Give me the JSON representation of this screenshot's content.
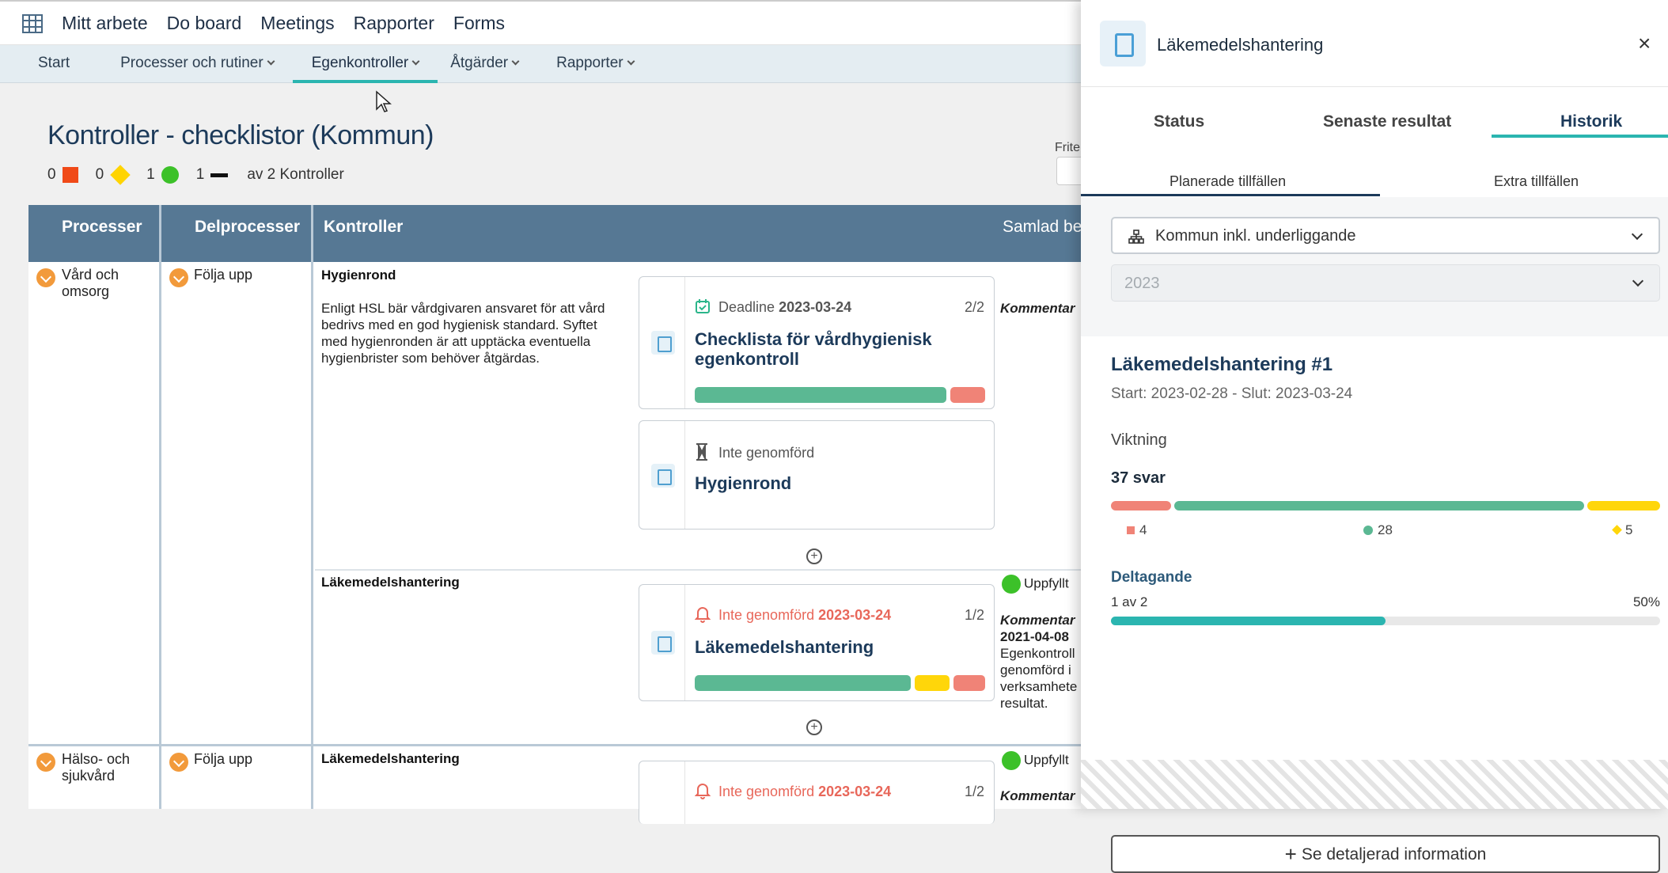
{
  "topnav": [
    "Mitt arbete",
    "Do board",
    "Meetings",
    "Rapporter",
    "Forms"
  ],
  "subnav": [
    {
      "label": "Start",
      "dropdown": false,
      "active": false
    },
    {
      "label": "Processer och rutiner",
      "dropdown": true,
      "active": false
    },
    {
      "label": "Egenkontroller",
      "dropdown": true,
      "active": true
    },
    {
      "label": "Åtgärder",
      "dropdown": true,
      "active": false
    },
    {
      "label": "Rapporter",
      "dropdown": true,
      "active": false
    }
  ],
  "page": {
    "title": "Kontroller - checklistor (Kommun)",
    "counts": {
      "red": "0",
      "yellow": "0",
      "green": "1",
      "black": "1",
      "suffix": "av 2 Kontroller"
    },
    "fritext_label": "Frite"
  },
  "table": {
    "headers": {
      "processer": "Processer",
      "delprocesser": "Delprocesser",
      "kontroller": "Kontroller",
      "samlad": "Samlad be"
    },
    "rows": [
      {
        "process": "Vård och omsorg",
        "delprocess": "Följa upp"
      },
      {
        "process": "Hälso- och sjukvård",
        "delprocess": "Följa upp"
      }
    ],
    "controls": [
      {
        "title": "Hygienrond",
        "desc": "Enligt HSL bär vårdgivaren ansvaret för att vård bedrivs med en god hygienisk standard. Syftet med hygienronden är att upptäcka eventuella hygienbrister som behöver åtgärdas.",
        "samlad_kommentar": "Kommentar",
        "cards": [
          {
            "status_prefix": "Deadline",
            "status_date": "2023-03-24",
            "frac": "2/2",
            "name": "Checklista för vårdhygienisk egenkontroll"
          },
          {
            "status_prefix": "Inte genomförd",
            "status_date": "",
            "frac": "",
            "name": "Hygienrond"
          }
        ]
      },
      {
        "title": "Läkemedelshantering",
        "samlad_status": "Uppfyllt",
        "samlad_kommentar": "Kommentar",
        "samlad_date": "2021-04-08",
        "samlad_text": [
          "Egenkontroll",
          "genomförd i",
          "verksamhete",
          "resultat."
        ],
        "cards": [
          {
            "status_prefix": "Inte genomförd",
            "status_date": "2023-03-24",
            "frac": "1/2",
            "name": "Läkemedelshantering"
          }
        ]
      },
      {
        "title": "Läkemedelshantering",
        "samlad_status": "Uppfyllt",
        "samlad_kommentar": "Kommentar",
        "cards": [
          {
            "status_prefix": "Inte genomförd",
            "status_date": "2023-03-24",
            "frac": "1/2",
            "name": ""
          }
        ]
      }
    ]
  },
  "panel": {
    "title": "Läkemedelshantering",
    "tabs": [
      "Status",
      "Senaste resultat",
      "Historik"
    ],
    "active_tab": "Historik",
    "subtabs": [
      "Planerade tillfällen",
      "Extra tillfällen"
    ],
    "org_select": "Kommun inkl. underliggande",
    "year_select": "2023",
    "history": {
      "title": "Läkemedelshantering #1",
      "range": "Start: 2023-02-28 - Slut: 2023-03-24",
      "viktning_label": "Viktning",
      "svar": "37 svar",
      "red": "4",
      "green": "28",
      "yellow": "5",
      "deltagande_label": "Deltagande",
      "deltagande_sub": "1 av 2",
      "deltagande_pct": "50%",
      "deltagande_value": 0.5,
      "button": "Se detaljerad information"
    }
  },
  "colors": {
    "teal": "#2bb5b0",
    "green": "#5bb893",
    "red": "#f08377",
    "yellow": "#ffd60a",
    "header": "#567894",
    "navy": "#1c3a5a"
  }
}
